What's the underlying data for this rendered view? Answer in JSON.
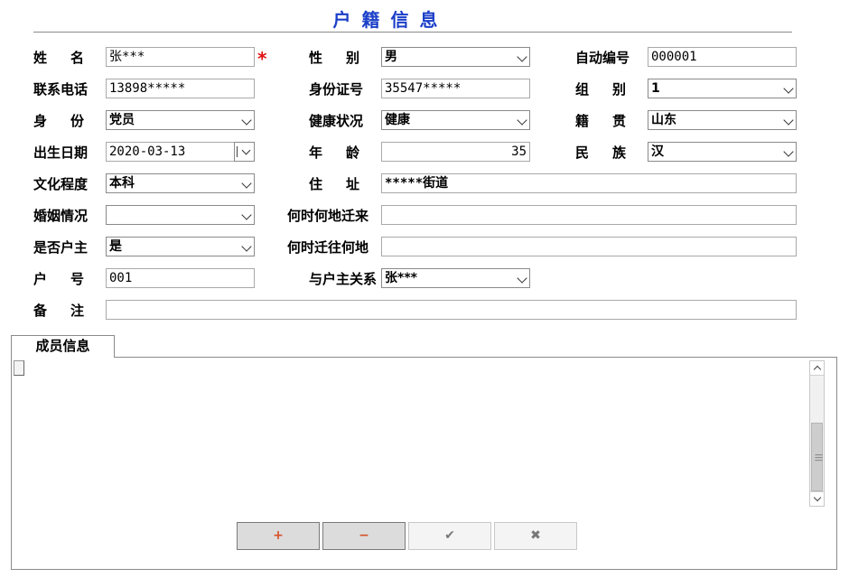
{
  "title": "户籍信息",
  "labels": {
    "name": "姓名",
    "gender": "性别",
    "auto_no": "自动编号",
    "phone": "联系电话",
    "id_no": "身份证号",
    "group": "组别",
    "identity": "身份",
    "health": "健康状况",
    "native_place": "籍贯",
    "birth_date": "出生日期",
    "age": "年龄",
    "ethnicity": "民族",
    "education": "文化程度",
    "address": "住址",
    "marital": "婚姻情况",
    "moved_in": "何时何地迁来",
    "is_head": "是否户主",
    "moved_out": "何时迁往何地",
    "household_no": "户号",
    "relation": "与户主关系",
    "remarks": "备注"
  },
  "values": {
    "name": "张***",
    "gender": "男",
    "auto_no": "000001",
    "phone": "13898*****",
    "id_no": "35547*****",
    "group": "1",
    "identity": "党员",
    "health": "健康",
    "native_place": "山东",
    "birth_date": "2020-03-13",
    "age": "35",
    "ethnicity": "汉",
    "education": "本科",
    "address": "*****街道",
    "marital": "",
    "moved_in": "",
    "is_head": "是",
    "moved_out": "",
    "household_no": "001",
    "relation": "张***",
    "remarks": ""
  },
  "required_mark": "*",
  "members_tab": "成员信息",
  "buttons": {
    "add": "+",
    "remove": "−",
    "confirm": "✔",
    "cancel": "✖"
  }
}
